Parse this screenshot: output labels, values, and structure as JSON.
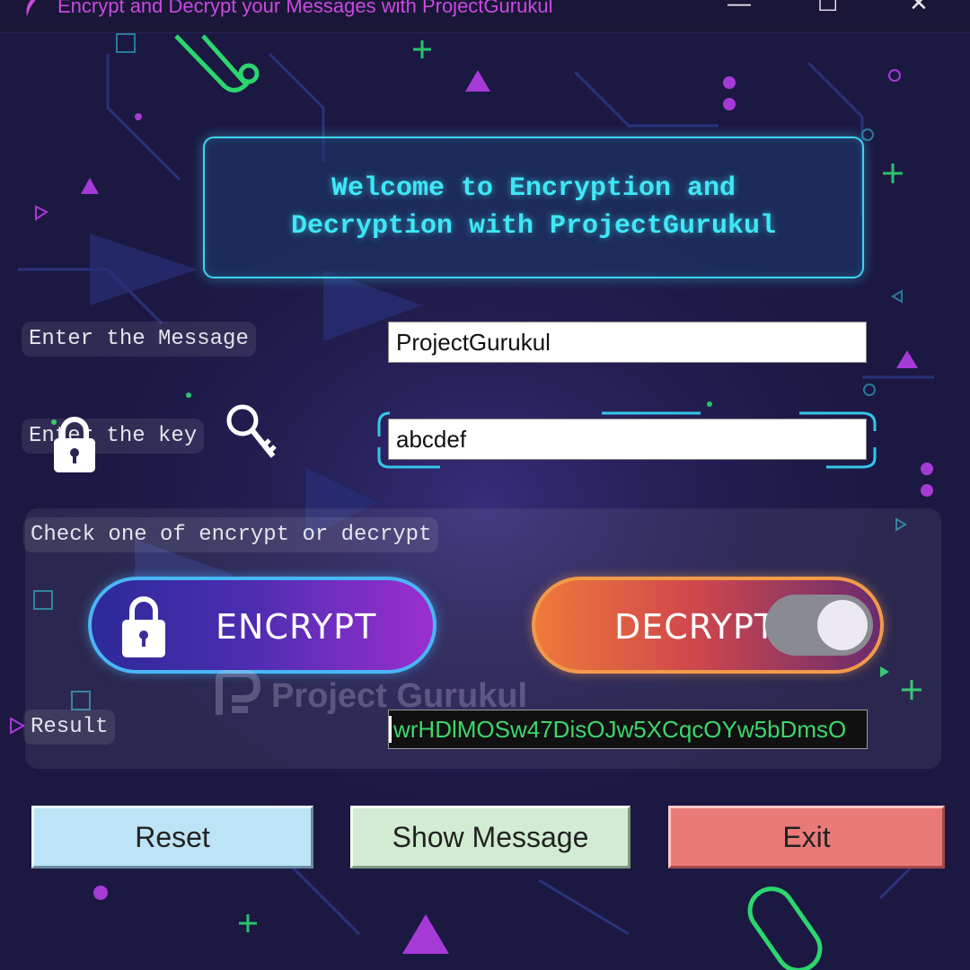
{
  "window": {
    "title": "Encrypt and Decrypt your Messages with ProjectGurukul",
    "controls": {
      "minimize": "—",
      "maximize": "☐",
      "close": "✕"
    }
  },
  "welcome": {
    "line1": "Welcome to Encryption and",
    "line2": "Decryption with ProjectGurukul"
  },
  "form": {
    "message_label": "Enter the Message",
    "message_value": "ProjectGurukul",
    "key_label": "Enter the key",
    "key_value": "abcdef",
    "check_label": "Check one of encrypt or decrypt",
    "result_label": "Result",
    "result_value": "wrHDlMOSw47DisOJw5XCqcOYw5bDmsO"
  },
  "mode": {
    "encrypt_label": "ENCRYPT",
    "decrypt_label": "DECRYPT",
    "decrypt_toggle_on": true
  },
  "watermark": {
    "text": "Project Gurukul"
  },
  "actions": {
    "reset_label": "Reset",
    "show_label": "Show Message",
    "exit_label": "Exit"
  },
  "colors": {
    "background": "#1d1a45",
    "welcome_text": "#3fe7f7",
    "title_text": "#c94ae0",
    "result_text": "#3dd66c",
    "reset_bg": "#bde3f6",
    "show_bg": "#d2ecd4",
    "exit_bg": "#ea7a78"
  },
  "icons": [
    "app-feather-icon",
    "padlock-icon",
    "key-icon",
    "toggle-switch-icon"
  ]
}
